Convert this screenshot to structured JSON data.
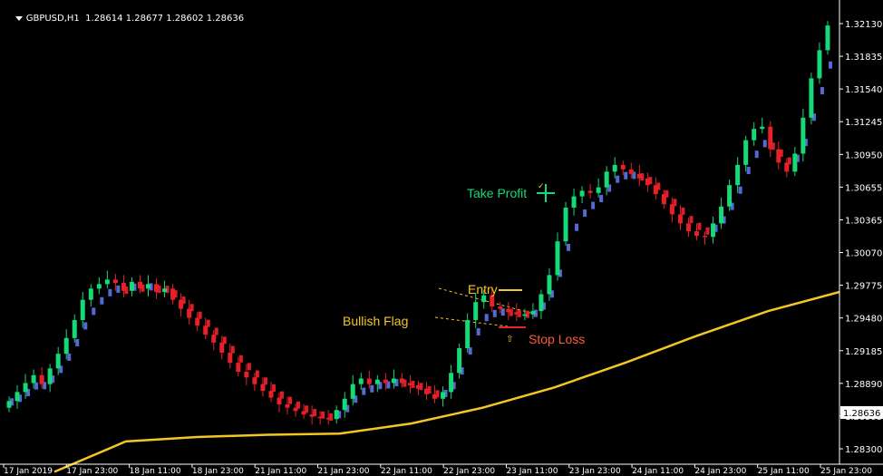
{
  "window": {
    "symbol": "GBPUSD,H1",
    "ohlc": "1.28614 1.28677 1.28602 1.28636"
  },
  "colors": {
    "background": "#000000",
    "bull_candle": "#16d978",
    "bear_candle": "#e8202a",
    "trend_line": "#5a6fdf",
    "ma_line": "#f3c623",
    "flag_line": "#f3c623",
    "axis_text": "#ffffff"
  },
  "price_axis": {
    "ticks": [
      "1.32130",
      "1.31835",
      "1.31540",
      "1.31245",
      "1.30950",
      "1.30655",
      "1.30365",
      "1.30070",
      "1.29775",
      "1.29480",
      "1.29185",
      "1.28890",
      "1.28595",
      "1.28300"
    ],
    "current_price": "1.28636"
  },
  "time_axis": {
    "ticks": [
      "17 Jan 2019",
      "17 Jan 23:00",
      "18 Jan 11:00",
      "18 Jan 23:00",
      "21 Jan 11:00",
      "21 Jan 23:00",
      "22 Jan 11:00",
      "22 Jan 23:00",
      "23 Jan 11:00",
      "23 Jan 23:00",
      "24 Jan 11:00",
      "24 Jan 23:00",
      "25 Jan 11:00",
      "25 Jan 23:00"
    ]
  },
  "annotations": {
    "take_profit": "Take Profit",
    "entry": "Entry",
    "bullish_flag": "Bullish Flag",
    "stop_loss": "Stop Loss"
  },
  "chart_data": {
    "type": "candlestick",
    "ylim": [
      1.2825,
      1.3225
    ],
    "grid": false,
    "close_series": [
      1.2878,
      1.2886,
      1.2894,
      1.2901,
      1.2893,
      1.2907,
      1.292,
      1.2934,
      1.295,
      1.2968,
      1.2978,
      1.2982,
      1.2986,
      1.2983,
      1.2976,
      1.2984,
      1.2978,
      1.2982,
      1.2975,
      1.2978,
      1.2968,
      1.296,
      1.2952,
      1.2945,
      1.2937,
      1.293,
      1.2921,
      1.2912,
      1.2904,
      1.2899,
      1.2893,
      1.2887,
      1.2881,
      1.2875,
      1.2872,
      1.2869,
      1.2866,
      1.2864,
      1.2863,
      1.2862,
      1.287,
      1.288,
      1.2893,
      1.2898,
      1.2893,
      1.2897,
      1.2894,
      1.2898,
      1.2894,
      1.2892,
      1.2889,
      1.2884,
      1.288,
      1.2886,
      1.2903,
      1.2925,
      1.295,
      1.2966,
      1.2972,
      1.2962,
      1.296,
      1.2957,
      1.2955,
      1.2955,
      1.2958,
      1.2973,
      1.299,
      1.302,
      1.305,
      1.306,
      1.3065,
      1.3063,
      1.3068,
      1.3082,
      1.3088,
      1.3084,
      1.308,
      1.3076,
      1.307,
      1.3062,
      1.3053,
      1.3044,
      1.3036,
      1.3029,
      1.3025,
      1.3024,
      1.3036,
      1.3051,
      1.307,
      1.3088,
      1.311,
      1.312,
      1.3122,
      1.3102,
      1.309,
      1.3082,
      1.3098,
      1.313,
      1.3165,
      1.319,
      1.3212
    ],
    "moving_average": [
      1.2815,
      1.2842,
      1.2846,
      1.2848,
      1.2849,
      1.2858,
      1.2872,
      1.289,
      1.2912,
      1.2936,
      1.2958,
      1.2975
    ]
  }
}
